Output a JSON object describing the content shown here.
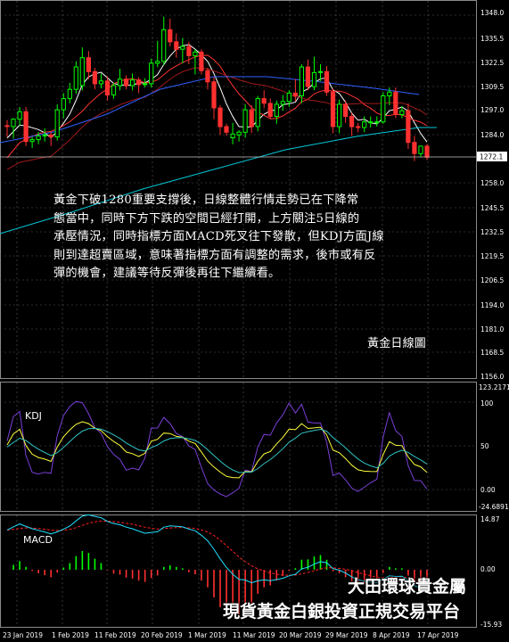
{
  "panels": {
    "price": {
      "axis_ticks": [
        "1348.0",
        "1335.5",
        "1322.5",
        "1309.5",
        "1297.0",
        "1284.0",
        "1258.0",
        "1245.5",
        "1232.5",
        "1219.5",
        "1206.5",
        "1194.0",
        "1181.0",
        "1168.5",
        "1156.0"
      ],
      "current_price": "1272.1",
      "chart_label": "黃金日線圖"
    },
    "kdj": {
      "label": "KDJ",
      "axis_ticks": [
        "123.2171",
        "100",
        "50",
        "0.00",
        "-24.6891"
      ]
    },
    "macd": {
      "label": "MACD",
      "axis_ticks": [
        "14.87",
        "0.00",
        "-15.93"
      ]
    }
  },
  "date_labels": [
    "23 Jan 2019",
    "1 Feb 2019",
    "11 Feb 2019",
    "20 Feb 2019",
    "1 Mar 2019",
    "11 Mar 2019",
    "20 Mar 2019",
    "29 Mar 2019",
    "8 Apr 2019",
    "17 Apr 2019"
  ],
  "annotation": {
    "lines": [
      "黃金下破1280重要支撐後，日線整體行情走勢已在下降常",
      "態當中，同時下方下跌的空間已經打開，上方關注5日線的",
      "承壓情況，同時指標方面MACD死叉往下發散，但KDJ方面J線",
      "則到達超賣區域，意味著指標方面有調整的需求，後市或有反",
      "彈的機會，建議等待反彈後再往下繼續看。"
    ]
  },
  "watermark": {
    "line1": "大田環球貴金屬",
    "line2": "現貨黃金白銀投資正規交易平台"
  },
  "colors": {
    "bull": "#00ff00",
    "bear": "#ff3030",
    "ma_white": "#ffffff",
    "ma_red": "#ff3333",
    "ma_maroon": "#a01a1a",
    "ma_blue": "#3060ff",
    "ma_cyan": "#00c8d8",
    "k_line": "#7b3fd8",
    "d_line": "#ffff3c",
    "j_line": "#2fc2c2",
    "macd_signal": "#ff2020",
    "macd_line": "#20e0ff"
  },
  "chart_data": {
    "type": "candlestick",
    "instrument": "XAUUSD",
    "timeframe": "Daily",
    "x": [
      "2019-01-15",
      "2019-01-16",
      "2019-01-17",
      "2019-01-18",
      "2019-01-21",
      "2019-01-22",
      "2019-01-23",
      "2019-01-24",
      "2019-01-25",
      "2019-01-28",
      "2019-01-29",
      "2019-01-30",
      "2019-01-31",
      "2019-02-01",
      "2019-02-04",
      "2019-02-05",
      "2019-02-06",
      "2019-02-07",
      "2019-02-08",
      "2019-02-11",
      "2019-02-12",
      "2019-02-13",
      "2019-02-14",
      "2019-02-15",
      "2019-02-18",
      "2019-02-19",
      "2019-02-20",
      "2019-02-21",
      "2019-02-22",
      "2019-02-25",
      "2019-02-26",
      "2019-02-27",
      "2019-02-28",
      "2019-03-01",
      "2019-03-04",
      "2019-03-05",
      "2019-03-06",
      "2019-03-07",
      "2019-03-08",
      "2019-03-11",
      "2019-03-12",
      "2019-03-13",
      "2019-03-14",
      "2019-03-15",
      "2019-03-18",
      "2019-03-19",
      "2019-03-20",
      "2019-03-21",
      "2019-03-22",
      "2019-03-25",
      "2019-03-26",
      "2019-03-27",
      "2019-03-28",
      "2019-03-29",
      "2019-04-01",
      "2019-04-02",
      "2019-04-03",
      "2019-04-04",
      "2019-04-05",
      "2019-04-08",
      "2019-04-09",
      "2019-04-10",
      "2019-04-11",
      "2019-04-12",
      "2019-04-15",
      "2019-04-16",
      "2019-04-17",
      "2019-04-18"
    ],
    "open": [
      1289.0,
      1288.5,
      1292.5,
      1296.5,
      1280.5,
      1281.5,
      1283.5,
      1284.0,
      1283.0,
      1297.5,
      1303.5,
      1308.5,
      1310.5,
      1325.5,
      1318.0,
      1311.5,
      1313.0,
      1305.5,
      1310.5,
      1314.0,
      1310.5,
      1313.5,
      1311.0,
      1311.5,
      1322.5,
      1323.5,
      1340.5,
      1334.0,
      1330.0,
      1331.5,
      1326.5,
      1328.5,
      1318.5,
      1312.5,
      1298.5,
      1288.5,
      1282.5,
      1284.0,
      1285.5,
      1297.5,
      1288.5,
      1303.5,
      1301.0,
      1294.0,
      1300.5,
      1302.0,
      1306.5,
      1305.0,
      1320.5,
      1310.0,
      1317.5,
      1318.0,
      1307.0,
      1288.5,
      1300.5,
      1294.0,
      1288.5,
      1288.0,
      1291.0,
      1291.0,
      1291.0,
      1305.0,
      1307.0,
      1295.0,
      1297.0,
      1280.0,
      1274.0,
      1278.0
    ],
    "high": [
      1292.0,
      1293.0,
      1299.0,
      1299.0,
      1283.0,
      1285.5,
      1287.5,
      1285.5,
      1300.5,
      1306.5,
      1312.0,
      1323.5,
      1331.0,
      1329.0,
      1320.0,
      1317.0,
      1315.5,
      1312.0,
      1319.5,
      1316.0,
      1317.0,
      1315.0,
      1314.5,
      1325.0,
      1334.5,
      1347.5,
      1346.5,
      1338.5,
      1336.0,
      1334.0,
      1330.0,
      1330.0,
      1320.0,
      1315.0,
      1300.0,
      1290.0,
      1290.5,
      1286.5,
      1300.5,
      1300.0,
      1305.0,
      1308.0,
      1303.5,
      1302.5,
      1305.5,
      1308.0,
      1314.0,
      1322.0,
      1324.5,
      1326.0,
      1322.0,
      1321.0,
      1309.0,
      1303.0,
      1302.5,
      1296.0,
      1290.5,
      1294.0,
      1294.0,
      1294.0,
      1307.0,
      1309.5,
      1309.5,
      1299.5,
      1301.0,
      1283.5,
      1276.5,
      1279.0
    ],
    "low": [
      1283.0,
      1282.0,
      1289.0,
      1278.0,
      1277.0,
      1279.0,
      1280.5,
      1278.0,
      1281.0,
      1293.0,
      1301.0,
      1306.0,
      1308.0,
      1314.0,
      1308.5,
      1309.0,
      1302.5,
      1303.5,
      1308.0,
      1308.5,
      1308.0,
      1306.5,
      1309.5,
      1309.5,
      1320.5,
      1321.5,
      1331.5,
      1325.5,
      1322.5,
      1322.0,
      1316.5,
      1316.5,
      1308.5,
      1292.5,
      1284.0,
      1283.5,
      1279.0,
      1280.5,
      1282.5,
      1285.0,
      1286.0,
      1298.5,
      1292.5,
      1290.0,
      1297.0,
      1299.0,
      1302.0,
      1301.0,
      1308.0,
      1308.0,
      1313.0,
      1305.0,
      1285.0,
      1285.0,
      1290.5,
      1283.5,
      1285.5,
      1285.5,
      1288.0,
      1288.5,
      1290.0,
      1300.0,
      1293.0,
      1293.0,
      1276.5,
      1270.0,
      1272.0,
      1270.5
    ],
    "close": [
      1288.5,
      1292.5,
      1296.5,
      1280.5,
      1281.5,
      1283.5,
      1284.0,
      1283.0,
      1297.5,
      1303.5,
      1308.5,
      1320.5,
      1325.5,
      1318.0,
      1311.5,
      1313.0,
      1305.5,
      1310.5,
      1314.0,
      1310.5,
      1313.5,
      1311.0,
      1311.5,
      1322.5,
      1323.5,
      1340.5,
      1334.0,
      1330.0,
      1331.5,
      1326.5,
      1328.5,
      1318.5,
      1312.5,
      1298.5,
      1288.5,
      1285.5,
      1284.5,
      1285.5,
      1297.5,
      1288.5,
      1303.5,
      1301.0,
      1294.0,
      1300.5,
      1302.0,
      1306.5,
      1305.0,
      1320.5,
      1310.0,
      1317.5,
      1318.0,
      1307.0,
      1288.5,
      1300.5,
      1294.0,
      1288.5,
      1288.0,
      1291.0,
      1291.0,
      1291.0,
      1305.0,
      1307.0,
      1295.0,
      1297.0,
      1280.0,
      1274.0,
      1278.0,
      1272.1
    ],
    "y_range": [
      1153.5,
      1355.5
    ]
  }
}
